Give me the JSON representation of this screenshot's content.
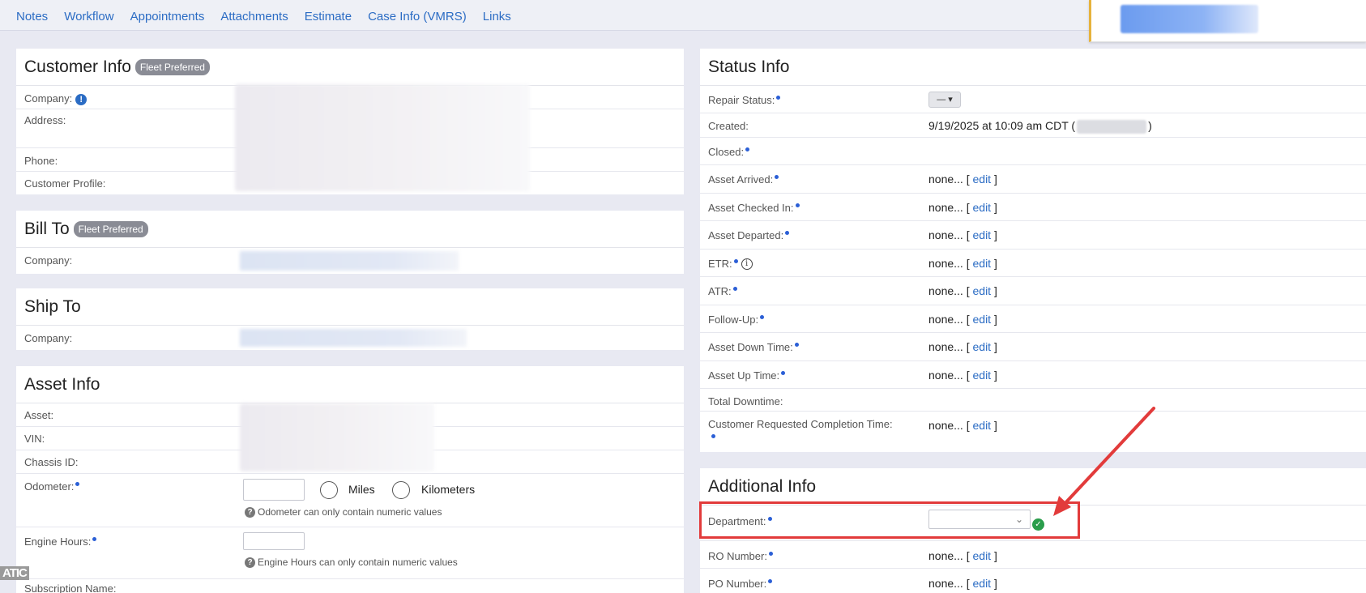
{
  "tabs": [
    "Notes",
    "Workflow",
    "Appointments",
    "Attachments",
    "Estimate",
    "Case Info (VMRS)",
    "Links"
  ],
  "customer_info": {
    "title": "Customer Info",
    "badge": "Fleet Preferred",
    "company_label": "Company:",
    "address_label": "Address:",
    "phone_label": "Phone:",
    "profile_label": "Customer Profile:"
  },
  "bill_to": {
    "title": "Bill To",
    "badge": "Fleet Preferred",
    "company_label": "Company:"
  },
  "ship_to": {
    "title": "Ship To",
    "company_label": "Company:"
  },
  "asset_info": {
    "title": "Asset Info",
    "asset_label": "Asset:",
    "vin_label": "VIN:",
    "chassis_label": "Chassis ID:",
    "odometer_label": "Odometer:",
    "miles_label": "Miles",
    "km_label": "Kilometers",
    "odometer_help": "Odometer can only contain numeric values",
    "engine_hours_label": "Engine Hours:",
    "engine_help": "Engine Hours can only contain numeric values",
    "subscription_label": "Subscription Name:"
  },
  "status_info": {
    "title": "Status Info",
    "repair_status_label": "Repair Status:",
    "repair_status_value": "— ▾",
    "created_label": "Created:",
    "created_value": "9/19/2025 at 10:09 am CDT (",
    "created_close": ")",
    "closed_label": "Closed:",
    "none_text": "none...",
    "edit_text": "edit",
    "rows": [
      {
        "label": "Asset Arrived:"
      },
      {
        "label": "Asset Checked In:"
      },
      {
        "label": "Asset Departed:"
      },
      {
        "label": "ETR:"
      },
      {
        "label": "ATR:"
      },
      {
        "label": "Follow-Up:"
      },
      {
        "label": "Asset Down Time:"
      },
      {
        "label": "Asset Up Time:"
      }
    ],
    "total_downtime_label": "Total Downtime:",
    "crct_label": "Customer Requested Completion Time:"
  },
  "additional_info": {
    "title": "Additional Info",
    "department_label": "Department:",
    "ro_label": "RO Number:",
    "po_label": "PO Number:"
  },
  "side_tag": "ATIC",
  "colors": {
    "link": "#2b6cc4",
    "highlight": "#e23b3b",
    "check": "#2a9d4b"
  }
}
